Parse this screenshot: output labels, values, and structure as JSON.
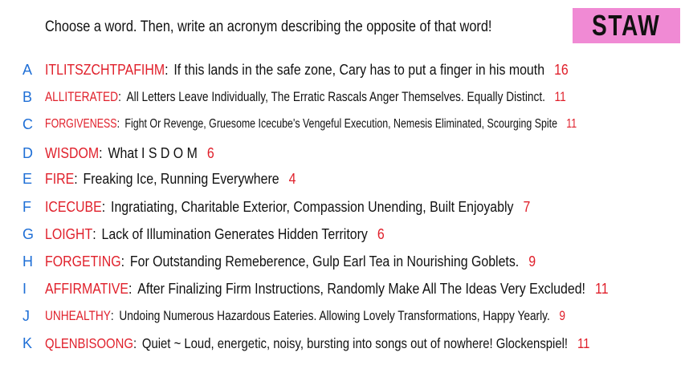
{
  "prompt": "Choose a word. Then, write an acronym describing the opposite of that word!",
  "tag": {
    "label": "STAW",
    "color": "#f08ad4"
  },
  "colors": {
    "letter": "#1f6fd6",
    "word": "#e0202b",
    "number": "#e0202b",
    "text": "#111111"
  },
  "rows": [
    {
      "letter": "A",
      "word": "ITLITSZCHTPAFIHM",
      "text": "If this lands in the safe zone, Cary has to put a finger in his mouth",
      "number": "16"
    },
    {
      "letter": "B",
      "word": "ALLITERATED",
      "text": "All Letters Leave Individually, The Erratic Rascals Anger Themselves. Equally Distinct.",
      "number": "11"
    },
    {
      "letter": "C",
      "word": "FORGIVENESS",
      "text": "Fight Or Revenge, Gruesome Icecube's Vengeful Execution,  Nemesis Eliminated, Scourging Spite",
      "number": "11"
    },
    {
      "letter": "D",
      "word": "WISDOM",
      "text": "What I S D O M",
      "number": "6"
    },
    {
      "letter": "E",
      "word": "FIRE",
      "text": "Freaking Ice, Running Everywhere",
      "number": "4"
    },
    {
      "letter": "F",
      "word": "ICECUBE",
      "text": "Ingratiating, Charitable Exterior, Compassion Unending, Built Enjoyably",
      "number": "7"
    },
    {
      "letter": "G",
      "word": "LOIGHT",
      "text": "Lack of Illumination Generates Hidden Territory",
      "number": "6"
    },
    {
      "letter": "H",
      "word": "FORGETING",
      "text": "For Outstanding Remeberence, Gulp Earl Tea in Nourishing Goblets.",
      "number": "9"
    },
    {
      "letter": "I",
      "word": "AFFIRMATIVE",
      "text": "After Finalizing Firm Instructions, Randomly Make All The Ideas Very Excluded!",
      "number": "11"
    },
    {
      "letter": "J",
      "word": "UNHEALTHY",
      "text": "Undoing Numerous Hazardous Eateries. Allowing Lovely Transformations, Happy Yearly.",
      "number": "9"
    },
    {
      "letter": "K",
      "word": "QLENBISOONG",
      "text": "Quiet ~ Loud, energetic, noisy, bursting into songs out of nowhere! Glockenspiel!",
      "number": "11"
    }
  ]
}
